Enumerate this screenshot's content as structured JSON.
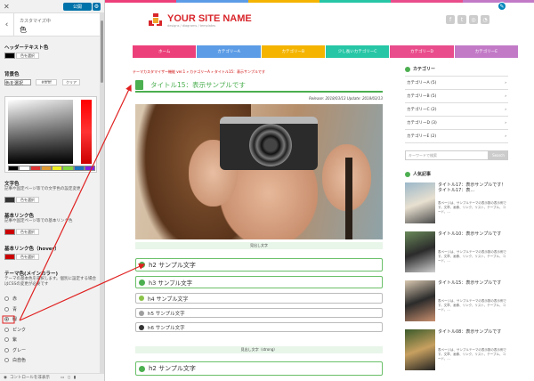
{
  "panel": {
    "publish_label": "公開",
    "customizing": "カスタマイズ中",
    "title": "色",
    "header_text_color_label": "ヘッダーテキスト色",
    "bg_color_label": "背景色",
    "bg_value": "#ffffff",
    "clear_label": "クリア",
    "text_color_label": "文字色",
    "text_color_desc": "記事や固定ページ等での文字色の設定変更",
    "link_color_label": "基本リンク色",
    "link_color_desc": "記事や固定ページ等での基本リンク色",
    "hover_color_label": "基本リンク色（hover）",
    "theme_color_label": "テーマ色(メインカラー)",
    "theme_color_desc": "テーマの基本色を選択します。個別に設定する場合はCSSの変更が必要です",
    "select_label": "色を選択",
    "radios": [
      "赤",
      "青",
      "緑",
      "ピンク",
      "紫",
      "グレー",
      "白自色"
    ],
    "selected_radio": 2,
    "footer_label": "コントロールを非表示"
  },
  "palette": [
    "#000000",
    "#ffffff",
    "#dd3333",
    "#dd9933",
    "#eeee22",
    "#81d742",
    "#1e73be",
    "#8224e3"
  ],
  "colors": {
    "accent": "#4caf50",
    "brand": "#d8262b",
    "wpblue": "#0073aa",
    "arrow": "#e02020"
  },
  "site": {
    "logo_name": "YOUR SITE NAME",
    "logo_tagline": "designs / diagrams / templates",
    "nav": [
      "ホーム",
      "カテゴリーA",
      "カテゴリーB",
      "少し長いカテゴリーC",
      "カテゴリーD",
      "カテゴリーE"
    ],
    "nav_colors": [
      "#ec407a",
      "#5c9ce6",
      "#f4b400",
      "#26c6a6",
      "#e94d8b",
      "#c27ac7"
    ],
    "breadcrumb": "テーマカスタマイザー機能 ver.1 » カテゴリーA » タイトル15：表示サンプルです",
    "post_title": "タイトル15：表示サンプルです",
    "meta": "Release: 2018/03/13 Update: 2018/03/13",
    "midline1": "見出し文字",
    "h2": "h2 サンプル文字",
    "h3": "h3 サンプル文字",
    "h4": "h4 サンプル文字",
    "h5": "h5 サンプル文字",
    "h6": "h6 サンプル文字",
    "midline2": "見出し文字（strong）",
    "h2b": "h2 サンプル文字",
    "sidebar": {
      "cat_title": "カテゴリー",
      "cats": [
        "カテゴリーA (5)",
        "カテゴリーB (5)",
        "カテゴリーC (2)",
        "カテゴリーD (3)",
        "カテゴリーE (2)"
      ],
      "search_placeholder": "キーワードで検索",
      "search_button": "Search",
      "popular_title": "人気記事",
      "posts": [
        {
          "title": "タイトル17：表示サンプルです！タイトル17：表...",
          "excerpt": "表ページは、サンプルテーマの表示数の表示例です。文章、画像、リンク、リスト、テーブル、コード、..."
        },
        {
          "title": "タイトル10：表示サンプルです",
          "excerpt": "表ページは、サンプルテーマの表示数の表示例です。文章、画像、リンク、リスト、テーブル、コード、..."
        },
        {
          "title": "タイトル15：表示サンプルです",
          "excerpt": "表ページは、サンプルテーマの表示数の表示例です。文章、画像、リンク、リスト、テーブル、コード、..."
        },
        {
          "title": "タイトル08：表示サンプルです",
          "excerpt": "表ページは、サンプルテーマの表示数の表示例です。文章、画像、リンク、リスト、テーブル、コード、..."
        }
      ]
    }
  },
  "icons": [
    "close-icon",
    "gear-icon",
    "back-chevron-icon",
    "facebook-icon",
    "twitter-icon",
    "instagram-icon",
    "rss-icon",
    "edit-pencil-icon",
    "document-icon",
    "arrow-right-icon"
  ]
}
